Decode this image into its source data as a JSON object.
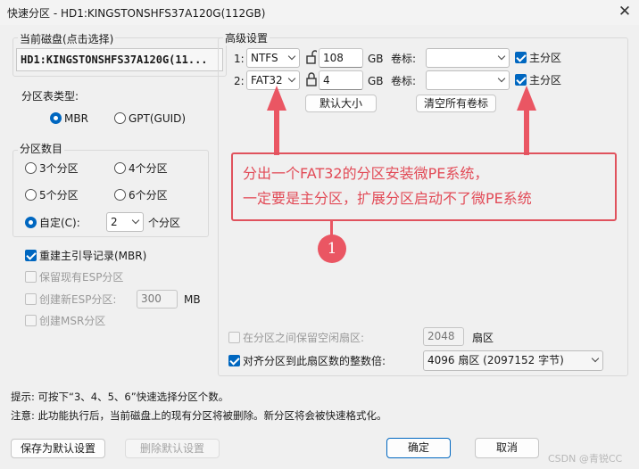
{
  "window": {
    "title": "快速分区 - HD1:KINGSTONSHFS37A120G(112GB)",
    "close_glyph": "✕"
  },
  "current_disk": {
    "label": "当前磁盘(点击选择)",
    "value": "HD1:KINGSTONSHFS37A120G(11..."
  },
  "table_type": {
    "label": "分区表类型:",
    "options": [
      "MBR",
      "GPT(GUID)"
    ],
    "selected": "MBR"
  },
  "partition_count": {
    "label": "分区数目",
    "options": [
      "3个分区",
      "4个分区",
      "5个分区",
      "6个分区"
    ],
    "custom_label": "自定(C):",
    "custom_value": "2",
    "custom_unit": "个分区",
    "selected": "custom"
  },
  "options": {
    "rebuild_mbr": {
      "label": "重建主引导记录(MBR)",
      "checked": true
    },
    "keep_esp": {
      "label": "保留现有ESP分区",
      "checked": false
    },
    "create_esp": {
      "label": "创建新ESP分区:",
      "size": "300",
      "unit": "MB",
      "checked": false
    },
    "create_msr": {
      "label": "创建MSR分区",
      "checked": false
    }
  },
  "advanced": {
    "label": "高级设置",
    "rows": [
      {
        "index": "1:",
        "fs": "NTFS",
        "size": "108",
        "unit": "GB",
        "vol_label": "卷标:",
        "primary_label": "主分区",
        "primary": true
      },
      {
        "index": "2:",
        "fs": "FAT32",
        "size": "4",
        "unit": "GB",
        "vol_label": "卷标:",
        "primary_label": "主分区",
        "primary": true
      }
    ],
    "default_size_btn": "默认大小",
    "clear_labels_btn": "清空所有卷标",
    "reserve_free": {
      "label": "在分区之间保留空闲扇区:",
      "value": "2048",
      "unit": "扇区",
      "checked": false
    },
    "align": {
      "label": "对齐分区到此扇区数的整数倍:",
      "value": "4096 扇区 (2097152 字节)",
      "checked": true
    }
  },
  "annotation": {
    "line1": "分出一个FAT32的分区安装微PE系统，",
    "line2": "一定要是主分区，扩展分区启动不了微PE系统",
    "badge": "1",
    "color": "#e24b57"
  },
  "hints": {
    "tip": "提示: 可按下“3、4、5、6”快速选择分区个数。",
    "note": "注意: 此功能执行后，当前磁盘上的现有分区将被删除。新分区将会被快速格式化。"
  },
  "buttons": {
    "save_default": "保存为默认设置",
    "delete_default": "删除默认设置",
    "ok": "确定",
    "cancel": "取消"
  },
  "watermark": "CSDN @青锐CC",
  "colors": {
    "accent": "#0067c0",
    "annotation": "#e24b57"
  }
}
